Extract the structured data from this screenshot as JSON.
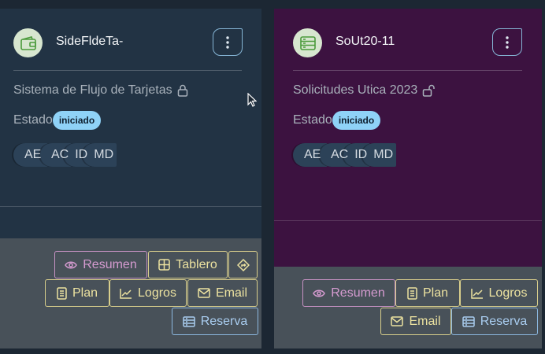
{
  "cards": [
    {
      "title": "SideFldeTa-",
      "description": "Sistema de Flujo de Tarjetas",
      "lock": "locked",
      "status_label": "Estado",
      "status": "iniciado",
      "members": [
        "AE",
        "AC",
        "ID",
        "MD"
      ],
      "actions": {
        "resumen": "Resumen",
        "tablero": "Tablero",
        "plan": "Plan",
        "logros": "Logros",
        "email": "Email",
        "reserva": "Reserva"
      }
    },
    {
      "title": "SoUt20-11",
      "description": "Solicitudes Utica 2023",
      "lock": "unlocked",
      "status_label": "Estado",
      "status": "iniciado",
      "members": [
        "AE",
        "AC",
        "ID",
        "MD"
      ],
      "actions": {
        "resumen": "Resumen",
        "plan": "Plan",
        "logros": "Logros",
        "email": "Email",
        "reserva": "Reserva"
      }
    }
  ],
  "colors": {
    "card1_bg": "#223344",
    "card2_bg": "#3c1240",
    "badge": "#8fd2f7",
    "pink": "#d59bd0",
    "yellow": "#ece2a0",
    "blue": "#a9cdf0"
  },
  "icons": [
    "wallet-icon",
    "server-icon",
    "kebab-menu-icon",
    "lock-icon",
    "unlock-icon",
    "eye-icon",
    "grid-icon",
    "directions-icon",
    "document-icon",
    "trend-icon",
    "mail-icon",
    "storage-icon"
  ]
}
